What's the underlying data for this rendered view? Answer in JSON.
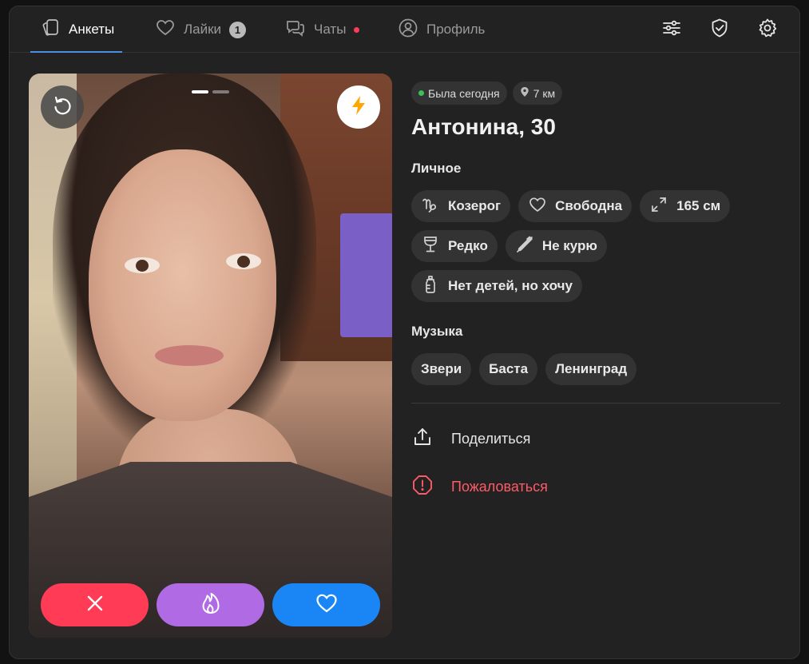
{
  "nav": {
    "tabs": [
      {
        "label": "Анкеты",
        "icon": "cards-icon",
        "active": true
      },
      {
        "label": "Лайки",
        "icon": "heart-icon",
        "badge": "1"
      },
      {
        "label": "Чаты",
        "icon": "chat-icon",
        "dot": true
      },
      {
        "label": "Профиль",
        "icon": "user-icon"
      }
    ],
    "actions": [
      "filters-icon",
      "shield-check-icon",
      "gear-icon"
    ]
  },
  "card": {
    "photo_indicators": [
      {
        "active": true
      },
      {
        "active": false
      }
    ],
    "buttons": {
      "undo": "undo-icon",
      "boost": "lightning-icon",
      "dislike": "close-icon",
      "super": "flame-icon",
      "like": "heart-icon"
    }
  },
  "profile": {
    "status": "Была сегодня",
    "distance": "7 км",
    "name_age": "Антонина, 30",
    "personal_title": "Личное",
    "personal_tags": [
      {
        "icon": "capricorn-icon",
        "label": "Козерог"
      },
      {
        "icon": "heart-icon",
        "label": "Свободна"
      },
      {
        "icon": "height-icon",
        "label": "165 см"
      },
      {
        "icon": "wine-glass-icon",
        "label": "Редко"
      },
      {
        "icon": "no-smoking-icon",
        "label": "Не курю"
      },
      {
        "icon": "baby-bottle-icon",
        "label": "Нет детей, но хочу"
      }
    ],
    "music_title": "Музыка",
    "music_tags": [
      "Звери",
      "Баста",
      "Ленинград"
    ],
    "share": "Поделиться",
    "report": "Пожаловаться"
  },
  "colors": {
    "accent": "#4b8fe3",
    "dislike": "#ff3b56",
    "super": "#b06be4",
    "like": "#1a86f5",
    "danger": "#ff5a67",
    "online": "#3ac15b"
  }
}
